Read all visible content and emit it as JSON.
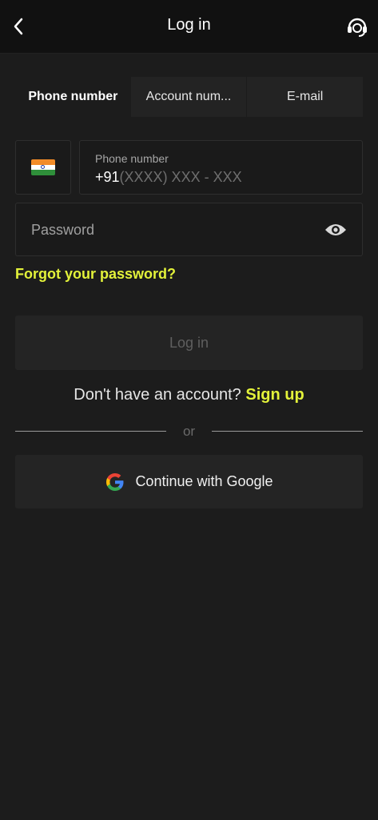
{
  "header": {
    "title": "Log in",
    "back_icon": "chevron-left-icon",
    "support_icon": "headset-support-icon"
  },
  "tabs": [
    {
      "label": "Phone number",
      "active": true
    },
    {
      "label": "Account num...",
      "active": false
    },
    {
      "label": "E-mail",
      "active": false
    }
  ],
  "phone": {
    "country_icon": "india-flag-icon",
    "label": "Phone number",
    "prefix": "+91",
    "placeholder": "(XXXX) XXX - XXX"
  },
  "password": {
    "placeholder": "Password",
    "toggle_icon": "eye-icon"
  },
  "forgot_password": "Forgot your password?",
  "login_button": "Log in",
  "signup": {
    "prompt": "Don't have an account?",
    "link": "Sign up"
  },
  "divider_text": "or",
  "google_button": {
    "icon": "google-icon",
    "label": "Continue with Google"
  },
  "colors": {
    "background": "#1c1c1c",
    "header_background": "#111111",
    "accent": "#e3f23a",
    "button_background": "#242424",
    "disabled_text": "#5f5f5f"
  }
}
